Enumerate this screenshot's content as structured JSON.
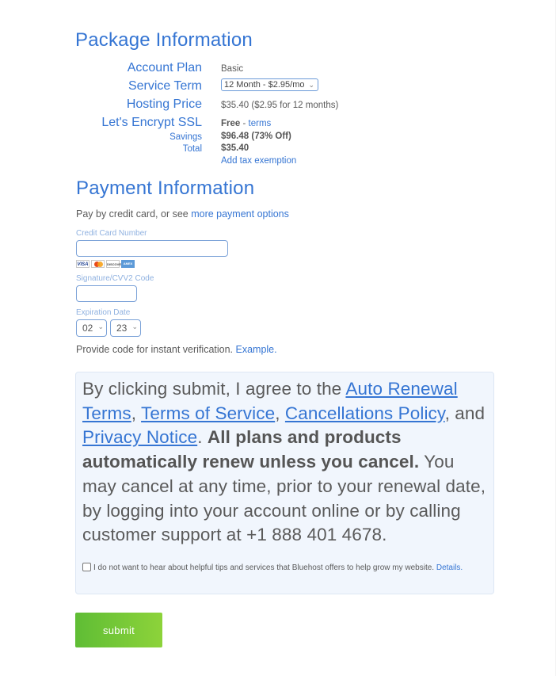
{
  "package": {
    "title": "Package Information",
    "rows": {
      "account_plan": {
        "label": "Account Plan",
        "value": "Basic"
      },
      "service_term": {
        "label": "Service Term",
        "selected": "12 Month - $2.95/mo"
      },
      "hosting_price": {
        "label": "Hosting Price",
        "value": "$35.40 ($2.95 for 12 months)"
      },
      "ssl": {
        "label": "Let's Encrypt SSL",
        "value": "Free",
        "separator": " - ",
        "link": "terms"
      },
      "savings": {
        "label": "Savings",
        "value": "$96.48 (73% Off)"
      },
      "total": {
        "label": "Total",
        "value": "$35.40"
      },
      "tax_link": "Add tax exemption"
    }
  },
  "payment": {
    "title": "Payment Information",
    "pay_text": "Pay by credit card, or see ",
    "more_options_link": "more payment options",
    "cc_label": "Credit Card Number",
    "cc_value": "",
    "card_icons": [
      "VISA",
      "MC",
      "DISCOVER",
      "AMEX"
    ],
    "cvv_label": "Signature/CVV2 Code",
    "cvv_value": "",
    "exp_label": "Expiration Date",
    "exp_month": "02",
    "exp_year": "23",
    "verify_text": "Provide code for instant verification. ",
    "example_link": "Example."
  },
  "agreement": {
    "intro": "By clicking submit, I agree to the ",
    "link_auto_renewal": "Auto Renewal Terms",
    "comma1": ", ",
    "link_tos": "Terms of Service",
    "comma2": ", ",
    "link_cancel": "Cancellations Policy",
    "and": ", and ",
    "link_privacy": "Privacy Notice",
    "period": ". ",
    "bold": "All plans and products automatically renew unless you cancel.",
    "rest": " You may cancel at any time, prior to your renewal date, by logging into your account online or by calling customer support at +1 888 401 4678.",
    "optout_text": "I do not want to hear about helpful tips and services that Bluehost offers to help grow my website. ",
    "optout_checked": false,
    "details_link": "Details."
  },
  "submit_label": "submit"
}
